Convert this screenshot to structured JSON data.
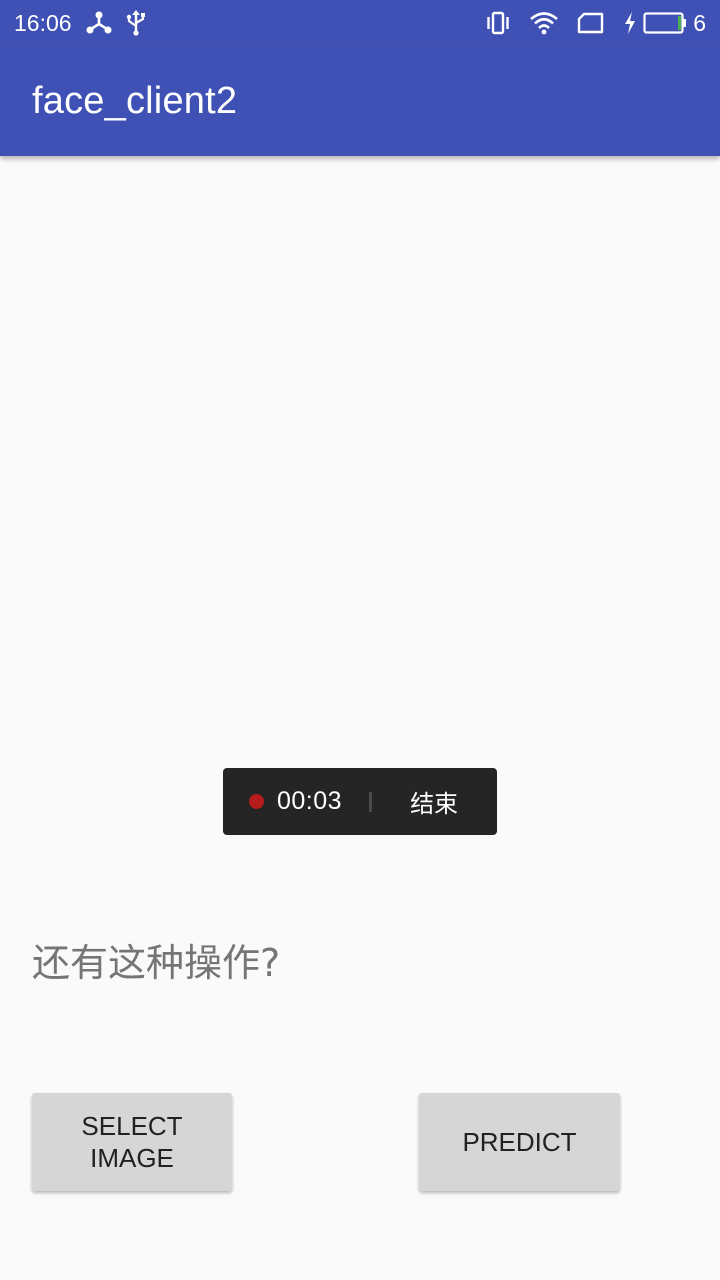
{
  "status_bar": {
    "time": "16:06",
    "battery_level": "6",
    "icons": [
      "network-share-icon",
      "usb-icon",
      "vibrate-icon",
      "wifi-icon",
      "sim-card-icon",
      "charging-icon",
      "battery-icon"
    ]
  },
  "app_bar": {
    "title": "face_client2"
  },
  "recorder": {
    "elapsed": "00:03",
    "end_label": "结束",
    "dot_color": "#b71c1c"
  },
  "main": {
    "result_text": "还有这种操作?",
    "select_image_label": "SELECT IMAGE",
    "predict_label": "PREDICT"
  },
  "colors": {
    "primary": "#3f51b5",
    "background": "#fafafa",
    "button": "#d6d6d6"
  }
}
